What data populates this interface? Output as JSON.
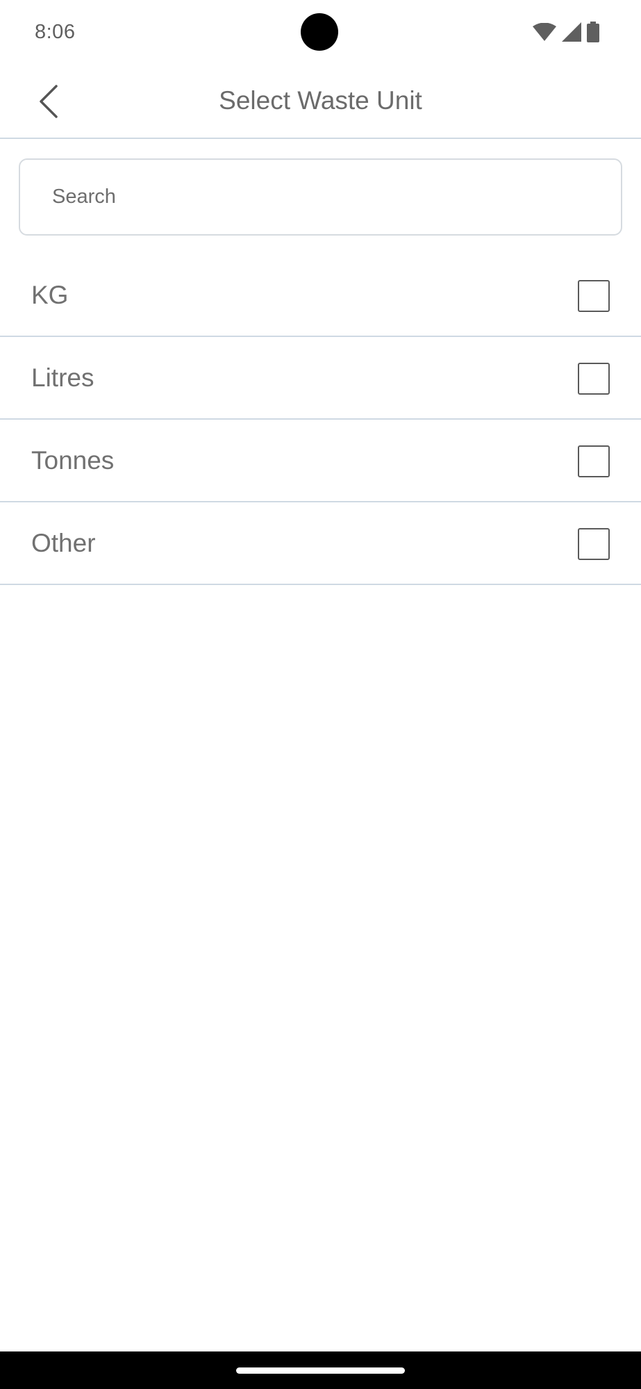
{
  "status_bar": {
    "time": "8:06",
    "icons": [
      "wifi-icon",
      "signal-icon",
      "battery-icon"
    ]
  },
  "header": {
    "title": "Select Waste Unit",
    "back_icon": "chevron-left-icon"
  },
  "search": {
    "placeholder": "Search",
    "value": ""
  },
  "units": [
    {
      "label": "KG",
      "checked": false
    },
    {
      "label": "Litres",
      "checked": false
    },
    {
      "label": "Tonnes",
      "checked": false
    },
    {
      "label": "Other",
      "checked": false
    }
  ],
  "colors": {
    "divider": "#cfd9e3",
    "title_text": "#6b6b6b",
    "label_text": "#717171",
    "checkbox_border": "#5a5a5a"
  }
}
